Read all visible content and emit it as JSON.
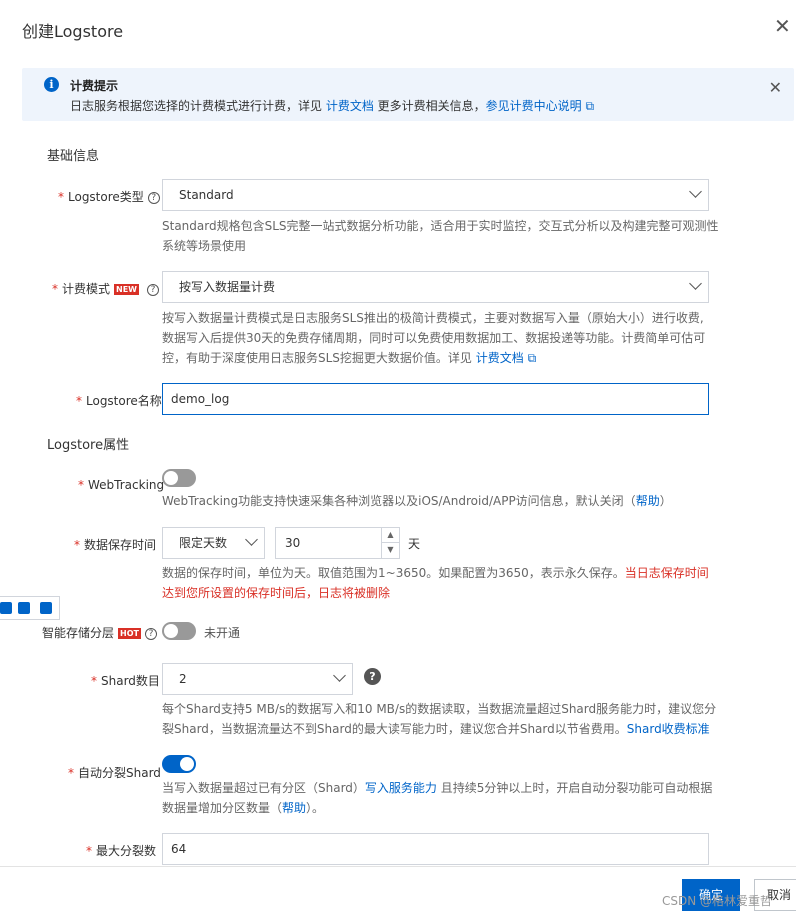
{
  "dialog": {
    "title": "创建Logstore"
  },
  "notice": {
    "title": "计费提示",
    "text_before": "日志服务根据您选择的计费模式进行计费，详见 ",
    "link1": "计费文档",
    "text_middle": "  更多计费相关信息，",
    "link2": "参见计费中心说明"
  },
  "sections": {
    "basic": "基础信息",
    "attrs": "Logstore属性"
  },
  "logstore_type": {
    "label": "Logstore类型",
    "value": "Standard",
    "desc_line1": "Standard规格包含SLS完整一站式数据分析功能，适合用于实时监控，交互式分析以及构建完整可观测性",
    "desc_line2": "系统等场景使用"
  },
  "billing_mode": {
    "label": "计费模式",
    "badge": "NEW",
    "value": "按写入数据量计费",
    "desc_line1": "按写入数据量计费模式是日志服务SLS推出的极简计费模式，主要对数据写入量（原始大小）进行收费,",
    "desc_line2": "数据写入后提供30天的免费存储周期，同时可以免费使用数据加工、数据投递等功能。计费简单可估可",
    "desc_line3": "控，有助于深度使用日志服务SLS挖掘更大数据价值。详见 ",
    "desc_link": "计费文档"
  },
  "logstore_name": {
    "label": "Logstore名称",
    "value": "demo_log"
  },
  "webtracking": {
    "label": "WebTracking",
    "enabled": false,
    "desc": "WebTracking功能支持快速采集各种浏览器以及iOS/Android/APP访问信息，默认关闭（",
    "desc_link": "帮助",
    "desc_end": "）"
  },
  "retention": {
    "label": "数据保存时间",
    "mode": "限定天数",
    "days": "30",
    "unit": "天",
    "desc_line1": "数据的保存时间，单位为天。取值范围为1~3650。如果配置为3650，表示永久保存。",
    "desc_red1": "当日志保存时间",
    "desc_red2": "达到您所设置的保存时间后，日志将被删除"
  },
  "smart_tier": {
    "label": "智能存储分层",
    "badge": "HOT",
    "enabled": false,
    "status": "未开通"
  },
  "shard": {
    "label": "Shard数目",
    "value": "2",
    "desc_line1": "每个Shard支持5 MB/s的数据写入和10 MB/s的数据读取，当数据流量超过Shard服务能力时，建议您分",
    "desc_line2": "裂Shard，当数据流量达不到Shard的最大读写能力时，建议您合并Shard以节省费用。",
    "desc_link": "Shard收费标准"
  },
  "auto_split": {
    "label": "自动分裂Shard",
    "enabled": true,
    "desc_line1_a": "当写入数据量超过已有分区（Shard）",
    "desc_link1": "写入服务能力",
    "desc_line1_b": " 且持续5分钟以上时，开启自动分裂功能可自动根据",
    "desc_line2_a": "数据量增加分区数量（",
    "desc_link2": "帮助",
    "desc_line2_b": "）。"
  },
  "max_split": {
    "label": "最大分裂数",
    "value": "64"
  },
  "footer": {
    "ok": "确定",
    "cancel": "取消"
  },
  "watermark": "CSDN @格林爱重哲"
}
